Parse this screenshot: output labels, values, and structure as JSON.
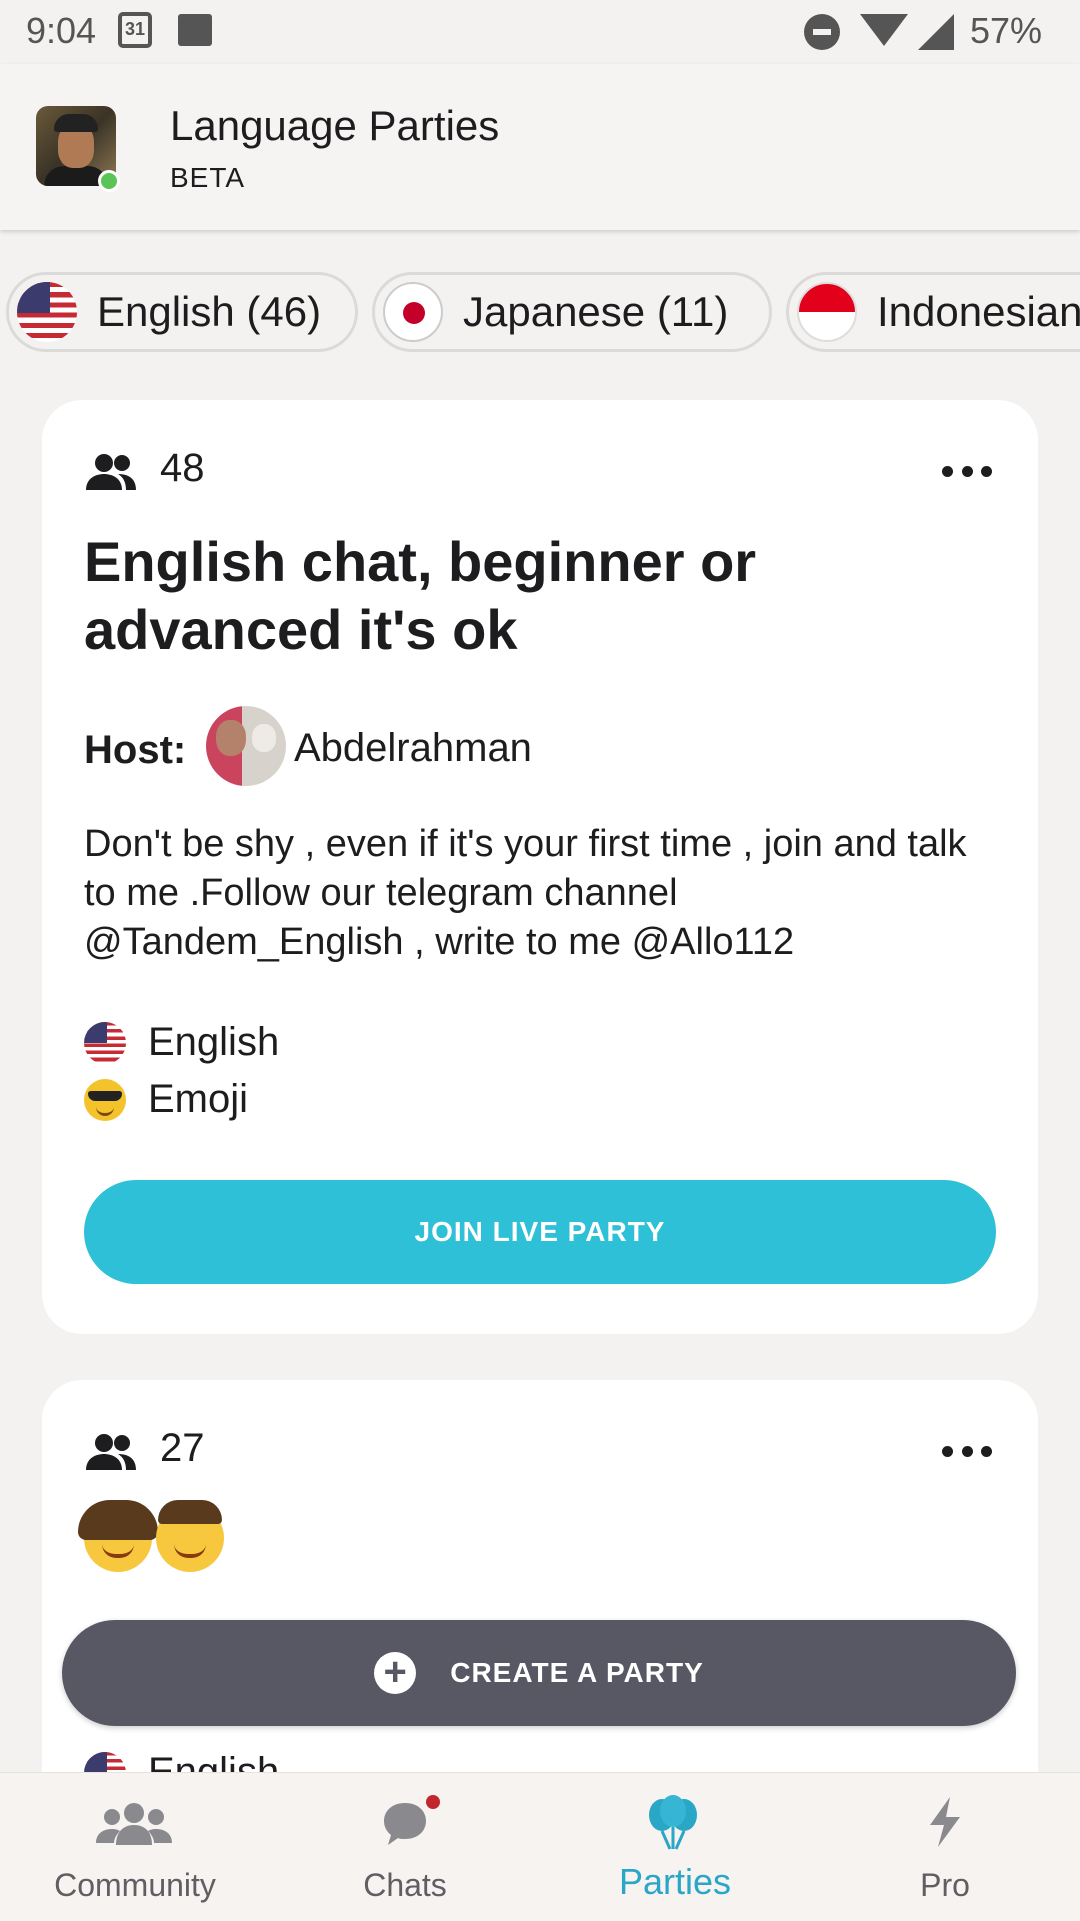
{
  "status_bar": {
    "time": "9:04",
    "calendar_day": "31",
    "battery": "57%"
  },
  "header": {
    "title": "Language Parties",
    "subtitle": "BETA"
  },
  "language_chips": [
    {
      "label": "English (46)",
      "flag": "us-flag"
    },
    {
      "label": "Japanese (11)",
      "flag": "japan-flag"
    },
    {
      "label": "Indonesian",
      "flag": "indonesia-flag"
    }
  ],
  "parties": [
    {
      "participants": "48",
      "title": "English chat, beginner or advanced it's ok",
      "host_label": "Host:",
      "host_name": "Abdelrahman",
      "description": "Don't be shy , even if it's your first time , join and talk to me .Follow our telegram channel @Tandem_English , write to me @Allo112",
      "languages": [
        "English",
        "Emoji"
      ],
      "join_label": "JOIN LIVE PARTY"
    },
    {
      "participants": "27",
      "title_emoji": "👧👦",
      "languages": [
        "English"
      ]
    }
  ],
  "create_party_label": "CREATE A PARTY",
  "bottom_nav": [
    {
      "label": "Community",
      "icon": "community-icon",
      "active": false
    },
    {
      "label": "Chats",
      "icon": "chat-bubble-icon",
      "active": false,
      "badge": true
    },
    {
      "label": "Parties",
      "icon": "balloons-icon",
      "active": true
    },
    {
      "label": "Pro",
      "icon": "lightning-icon",
      "active": false
    }
  ],
  "colors": {
    "accent": "#2ec0d6",
    "active_nav": "#2aa6c6",
    "create_button": "#575864",
    "online": "#5cc356"
  }
}
